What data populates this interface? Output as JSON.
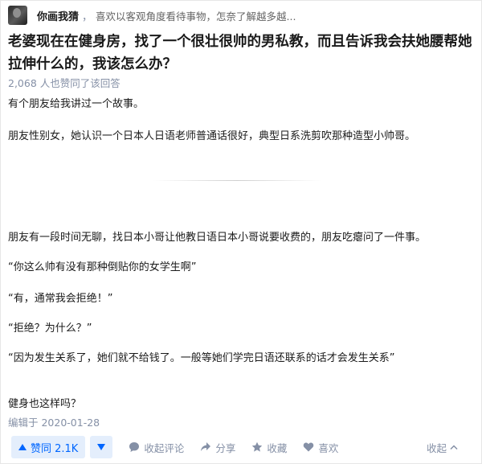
{
  "author": {
    "name": "你画我猜",
    "separator": "，",
    "bio": "喜欢以客观角度看待事物，怎奈了解越多越..."
  },
  "question": {
    "title": "老婆现在在健身房，找了一个很壮很帅的男私教，而且告诉我会扶她腰帮她拉伸什么的，我该怎么办？"
  },
  "answer": {
    "likes_text": "2,068 人也赞同了该回答",
    "paragraphs": [
      "有个朋友给我讲过一个故事。",
      "朋友性别女，她认识一个日本人日语老师普通话很好，典型日系洗剪吹那种造型小帅哥。",
      "朋友有一段时间无聊，找日本小哥让他教日语日本小哥说要收费的，朋友吃瘪问了一件事。",
      "“你这么帅有没有那种倒贴你的女学生啊”",
      "“有，通常我会拒绝！”",
      "“拒绝？为什么？”",
      "“因为发生关系了，她们就不给钱了。一般等她们学完日语还联系的话才会发生关系”",
      "健身也这样吗？"
    ],
    "edited_text": "编辑于 2020-01-28"
  },
  "actions": {
    "upvote_label": "赞同 2.1K",
    "comment_label": "收起评论",
    "share_label": "分享",
    "favorite_label": "收藏",
    "like_label": "喜欢",
    "collapse_label": "收起"
  },
  "colors": {
    "accent": "#0066ff",
    "accent_bg": "#e4eefc",
    "muted": "#8590a6",
    "text": "#1a1a1a"
  },
  "icons": {
    "upvote": "triangle-up-icon",
    "downvote": "triangle-down-icon",
    "comment": "comment-bubble-icon",
    "share": "share-arrow-icon",
    "favorite": "star-icon",
    "like": "heart-icon",
    "collapse": "chevron-up-icon"
  }
}
